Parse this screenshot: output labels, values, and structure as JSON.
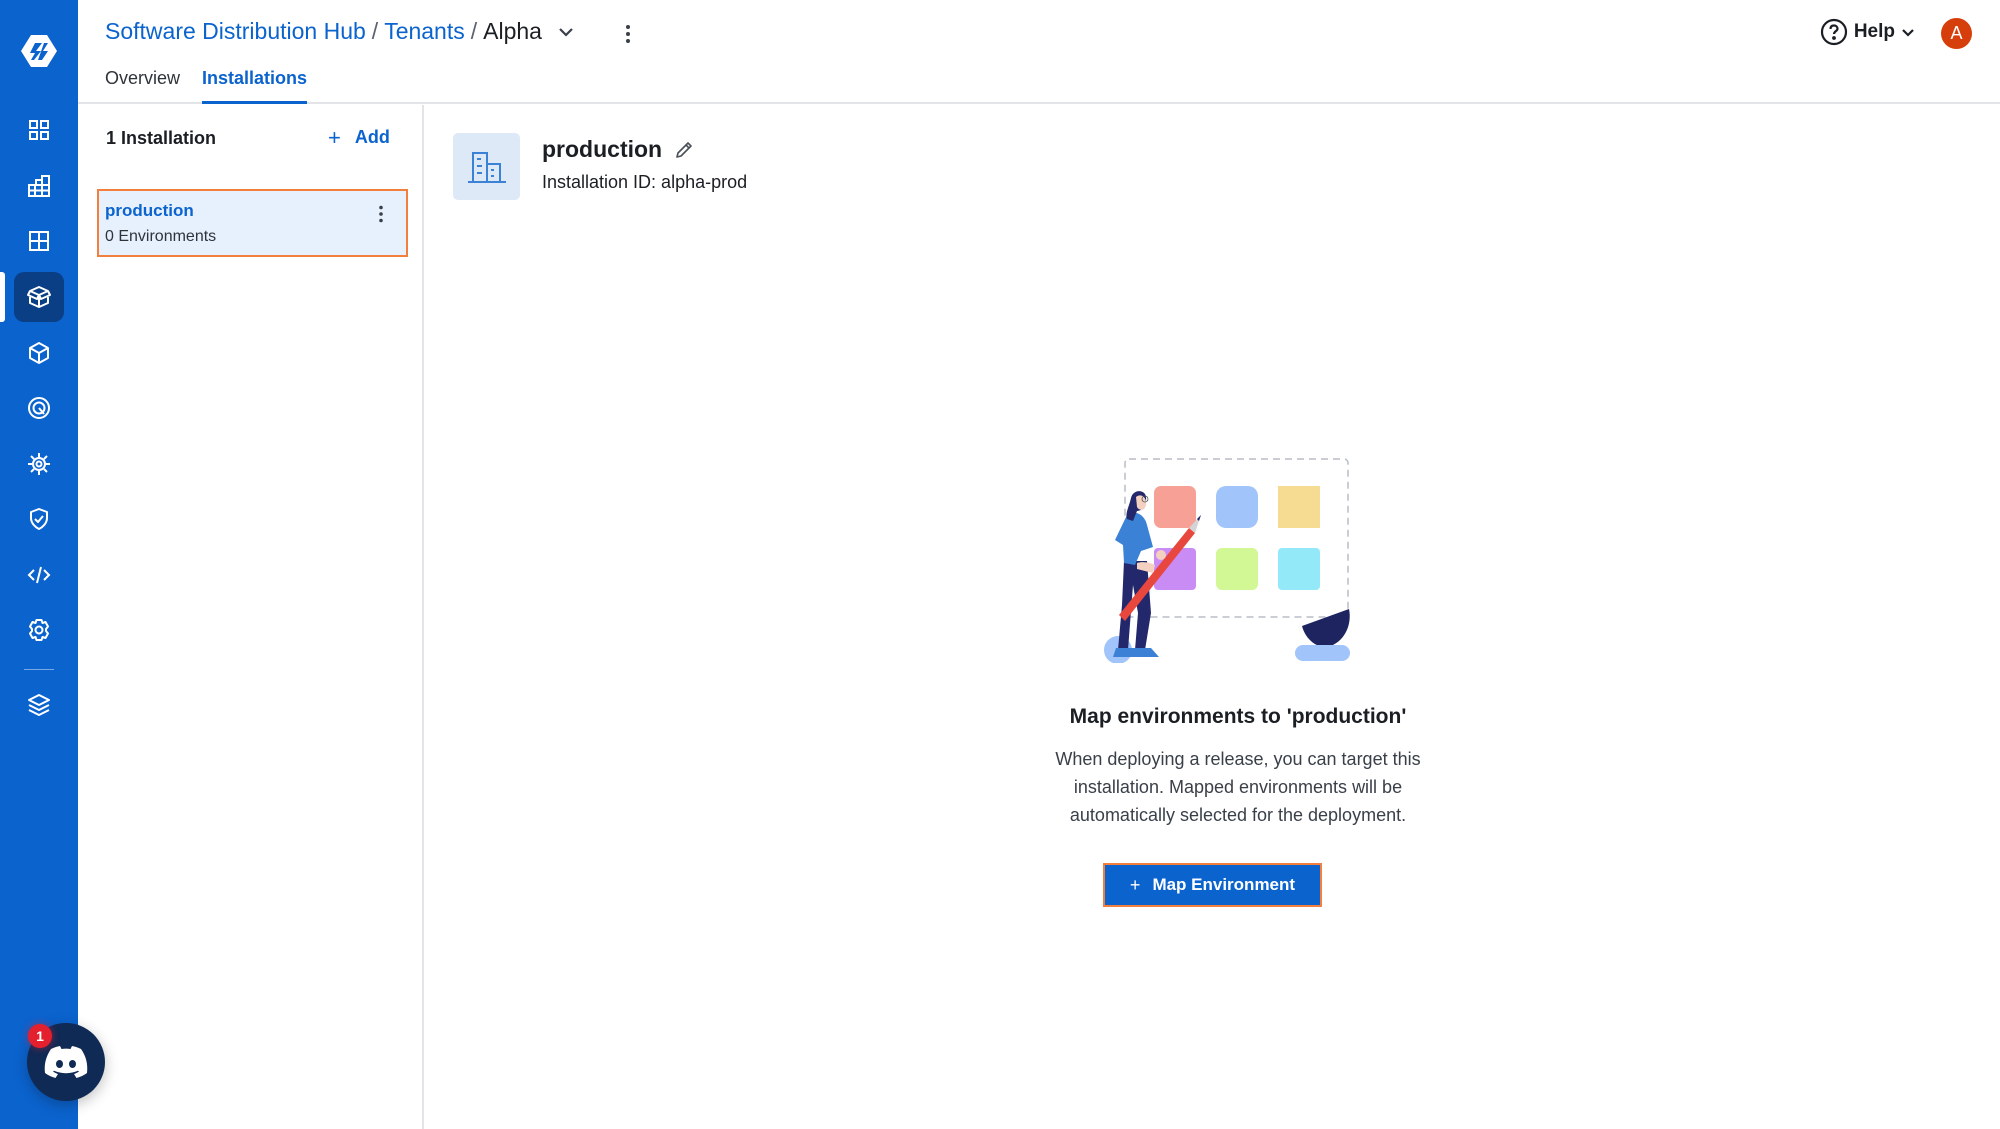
{
  "breadcrumb": {
    "items": [
      "Software Distribution Hub",
      "Tenants"
    ],
    "separator": "/",
    "current": "Alpha"
  },
  "tabs": [
    {
      "label": "Overview",
      "active": false
    },
    {
      "label": "Installations",
      "active": true
    }
  ],
  "header": {
    "help_label": "Help",
    "avatar_initial": "A",
    "avatar_color": "#d63f0b"
  },
  "sidebar": {
    "brand_color": "#0b63ce",
    "items": [
      {
        "icon": "dashboard-icon",
        "active": false
      },
      {
        "icon": "chart-grid-icon",
        "active": false
      },
      {
        "icon": "grid-icon",
        "active": false
      },
      {
        "icon": "open-box-icon",
        "active": true
      },
      {
        "icon": "cube-icon",
        "active": false
      },
      {
        "icon": "radar-icon",
        "active": false
      },
      {
        "icon": "sun-gear-icon",
        "active": false
      },
      {
        "icon": "shield-check-icon",
        "active": false
      },
      {
        "icon": "code-icon",
        "active": false
      },
      {
        "icon": "settings-icon",
        "active": false
      },
      {
        "icon": "layers-icon",
        "active": false
      }
    ]
  },
  "installations": {
    "count_label": "1 Installation",
    "add_label": "Add",
    "items": [
      {
        "name": "production",
        "environments": "0 Environments",
        "selected": true
      }
    ]
  },
  "detail": {
    "title": "production",
    "id_label": "Installation ID: alpha-prod"
  },
  "empty_state": {
    "title": "Map environments to 'production'",
    "description": "When deploying a release, you can target this installation. Mapped environments will be automatically selected for the deployment.",
    "button_label": "Map Environment"
  },
  "chat": {
    "badge_count": "1"
  }
}
